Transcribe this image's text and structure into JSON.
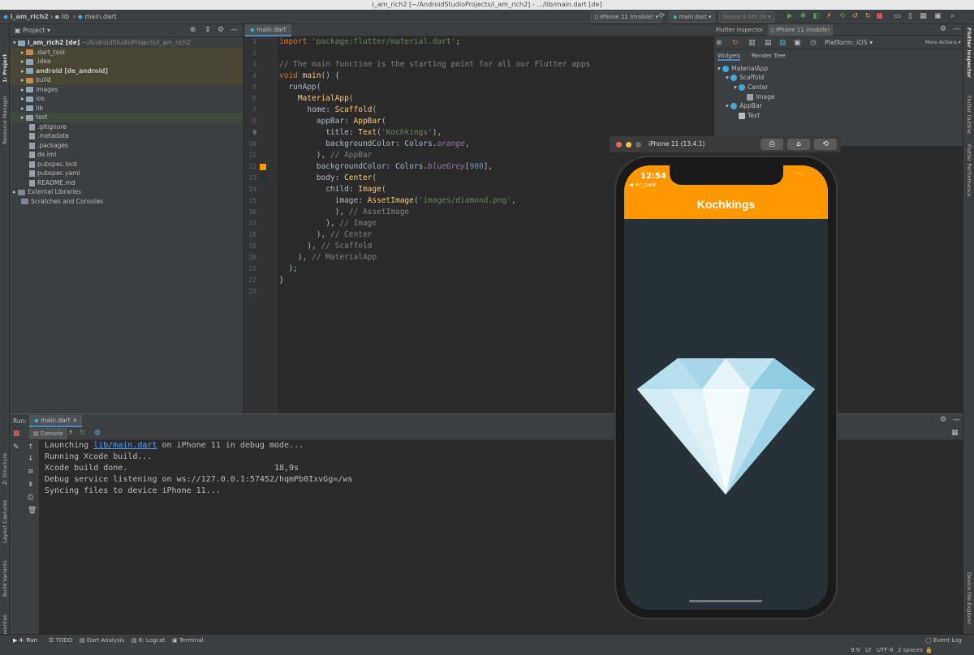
{
  "window": {
    "title": "i_am_rich2 [~/AndroidStudioProjects/i_am_rich2] - .../lib/main.dart [de]"
  },
  "navbar": {
    "crumbs": [
      "i_am_rich2",
      "lib",
      "main.dart"
    ],
    "device": "iPhone 11 (mobile)",
    "run_config": "main.dart",
    "avd": "Nexus 6 API 28"
  },
  "left_tabs": [
    "1: Project",
    "Resource Manager",
    "Z: Structure",
    "Layout Captures",
    "Build Variants",
    "2: Favorites"
  ],
  "right_tabs": [
    "Flutter Inspector",
    "Flutter Outline",
    "Flutter Performance",
    "Device File Explorer"
  ],
  "project": {
    "header": "Project",
    "root": "i_am_rich2 [de]",
    "root_path": "~/AndroidStudioProjects/i_am_rich2",
    "items": [
      {
        "label": ".dart_tool",
        "type": "folder-orange",
        "hl": "hl"
      },
      {
        "label": ".idea",
        "type": "folder",
        "hl": "hl"
      },
      {
        "label": "android [de_android]",
        "type": "folder",
        "hl": "hl"
      },
      {
        "label": "build",
        "type": "folder-orange",
        "hl": "hl"
      },
      {
        "label": "images",
        "type": "folder",
        "hl": ""
      },
      {
        "label": "ios",
        "type": "folder",
        "hl": ""
      },
      {
        "label": "lib",
        "type": "folder",
        "hl": ""
      },
      {
        "label": "test",
        "type": "folder",
        "hl": "hl2"
      },
      {
        "label": ".gitignore",
        "type": "file",
        "hl": ""
      },
      {
        "label": ".metadata",
        "type": "file",
        "hl": ""
      },
      {
        "label": ".packages",
        "type": "file",
        "hl": ""
      },
      {
        "label": "de.iml",
        "type": "file",
        "hl": ""
      },
      {
        "label": "pubspec.lock",
        "type": "file",
        "hl": ""
      },
      {
        "label": "pubspec.yaml",
        "type": "file",
        "hl": ""
      },
      {
        "label": "README.md",
        "type": "file",
        "hl": ""
      }
    ],
    "external": "External Libraries",
    "scratches": "Scratches and Consoles"
  },
  "editor": {
    "tab": "main.dart",
    "line_numbers": [
      "1",
      "2",
      "3",
      "4",
      "5",
      "6",
      "7",
      "8",
      "9",
      "10",
      "11",
      "12",
      "13",
      "14",
      "15",
      "16",
      "17",
      "18",
      "19",
      "20",
      "21",
      "22",
      "23"
    ]
  },
  "inspector": {
    "tab1": "Flutter Inspector",
    "tab2": "iPhone 11 (mobile)",
    "platform": "Platform: iOS",
    "more_actions": "More Actions",
    "sub_tabs": [
      "Widgets",
      "Render Tree"
    ],
    "tree": [
      "MaterialApp",
      "Scaffold",
      "Center",
      "Image",
      "AppBar",
      "Text"
    ]
  },
  "run": {
    "label": "Run:",
    "config": "main.dart",
    "console_tab": "Console",
    "lines": {
      "l1_pre": "Launching ",
      "l1_link": "lib/main.dart",
      "l1_post": " on iPhone 11 in debug mode...",
      "l2": "Running Xcode build...",
      "l3": "Xcode build done.                              18,9s",
      "l4": "Debug service listening on ws://127.0.0.1:57452/hqmPb0IxvGg=/ws",
      "l5": "Syncing files to device iPhone 11..."
    }
  },
  "bottom": {
    "tabs": [
      "4: Run",
      "TODO",
      "Dart Analysis",
      "6: Logcat",
      "Terminal"
    ],
    "event_log": "Event Log",
    "status": [
      "9:9",
      "LF",
      "UTF-8",
      "2 spaces"
    ]
  },
  "simulator": {
    "title": "iPhone 11 (13.4.1)",
    "time": "12:54",
    "back": "◀ ml_card",
    "debug": "DEBUG",
    "app_title": "Kochkings"
  }
}
